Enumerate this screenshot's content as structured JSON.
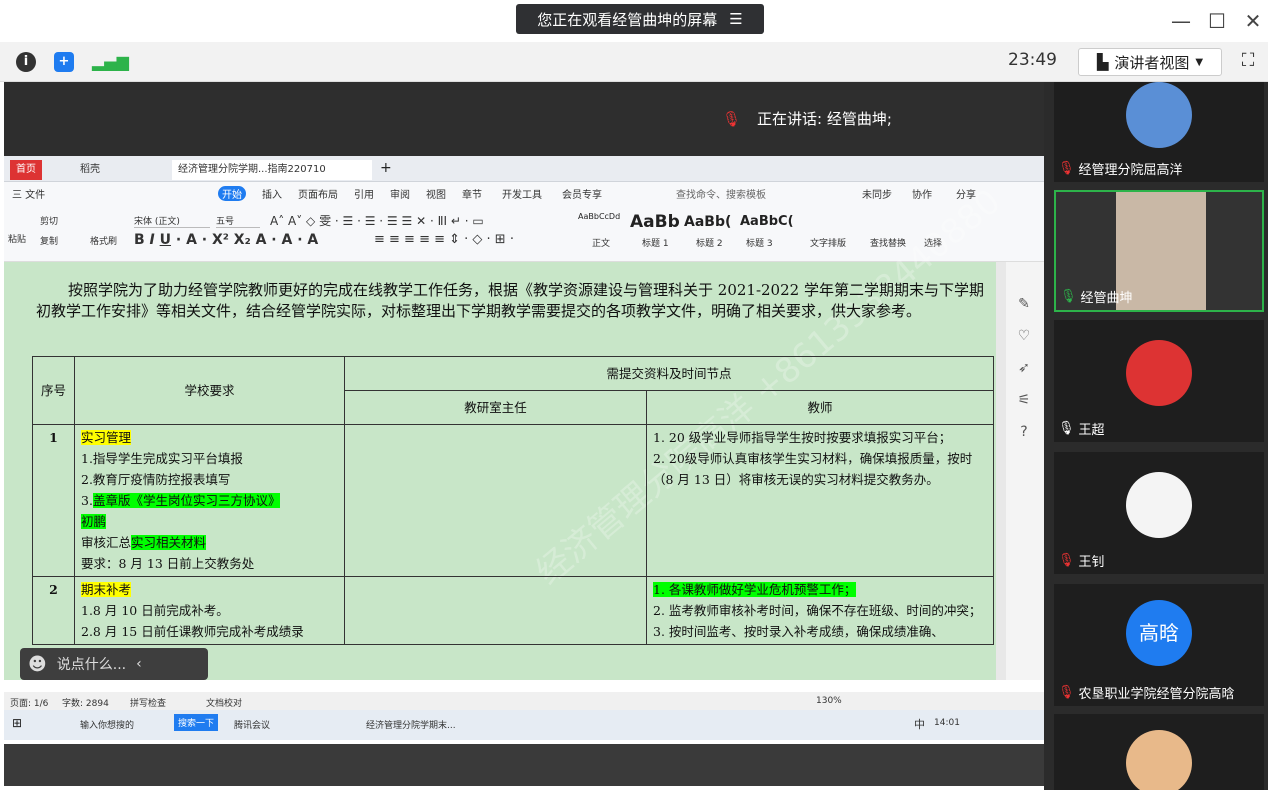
{
  "window": {
    "banner": "您正在观看经管曲坤的屏幕",
    "banner_icon": "menu-icon",
    "clock": "23:49",
    "presenter_view": "演讲者视图"
  },
  "speaker": {
    "speaking_label": "正在讲话: 经管曲坤;"
  },
  "wps": {
    "tabs": [
      "首页",
      "稻壳",
      "经济管理分院学期...指南220710"
    ],
    "menu": [
      "三 文件",
      "开始",
      "插入",
      "页面布局",
      "引用",
      "审阅",
      "视图",
      "章节",
      "开发工具",
      "会员专享"
    ],
    "search_placeholder": "查找命令、搜索模板",
    "sync": "未同步",
    "collab": "协作",
    "share": "分享",
    "ribbon": {
      "font": "宋体 (正文)",
      "size": "五号",
      "styles": [
        "正文",
        "标题 1",
        "标题 2",
        "标题 3"
      ],
      "style_samples": [
        "AaBbCcDd",
        "AaBb",
        "AaBb(",
        "AaBbC("
      ],
      "typeset": "文字排版",
      "findreplace": "查找替换",
      "select": "选择",
      "paste": "粘贴",
      "cut": "剪切",
      "copy": "复制",
      "format_painter": "格式刷"
    },
    "paragraph": "按照学院为了助力经管学院教师更好的完成在线教学工作任务，根据《教学资源建设与管理科关于 2021-2022 学年第二学期期末与下学期初教学工作安排》等相关文件，结合经管学院实际，对标整理出下学期教学需要提交的各项教学文件，明确了相关要求，供大家参考。",
    "table": {
      "h_seq": "序号",
      "h_school": "学校要求",
      "h_need": "需提交资料及时间节点",
      "h_director": "教研室主任",
      "h_teacher": "教师",
      "r1_seq": "1",
      "r1_title": "实习管理",
      "r1_l1": "1.指导学生完成实习平台填报",
      "r1_l2": "2.教育厅疫情防控报表填写",
      "r1_l3a": "3.",
      "r1_l3b": "盖章版《学生岗位实习三方协议》",
      "r1_l4": "初鹏",
      "r1_l5a": "审核汇总",
      "r1_l5b": "实习相关材料",
      "r1_l6": "要求：8 月 13 日前上交教务处",
      "r1_t1": "1. 20 级学业导师指导学生按时按要求填报实习平台；",
      "r1_t2": "2. 20级导师认真审核学生实习材料，确保填报质量，按时（8 月 13 日）将审核无误的实习材料提交教务办。",
      "r2_seq": "2",
      "r2_title": "期末补考",
      "r2_l1": "1.8 月 10 日前完成补考。",
      "r2_l2": "2.8 月 15 日前任课教师完成补考成绩录",
      "r2_t1": "1. 各课教师做好学业危机预警工作；",
      "r2_t2": "2. 监考教师审核补考时间，确保不存在班级、时间的冲突；",
      "r2_t3": "3. 按时间监考、按时录入补考成绩，确保成绩准确、"
    },
    "watermark": "经济管理分院高洋 +8613938440880",
    "status": {
      "page": "页面: 1/6",
      "words": "字数: 2894",
      "spell": "拼写检查",
      "proof": "文档校对",
      "zoom": "130%"
    },
    "taskbar": {
      "search": "输入你想搜的",
      "btn1": "搜索一下",
      "app1": "腾讯会议",
      "app2": "经济管理分院学期末...",
      "ime": "中",
      "time": "14:01"
    }
  },
  "chat": {
    "placeholder": "说点什么..."
  },
  "participants": [
    {
      "name": "经管理分院屈高洋",
      "muted": true
    },
    {
      "name": "经管曲坤",
      "muted": false
    },
    {
      "name": "王超",
      "muted": false
    },
    {
      "name": "王钊",
      "muted": true
    },
    {
      "name": "农垦职业学院经管分院高晗",
      "muted": true,
      "avatar_text": "高晗"
    }
  ],
  "colors": {
    "accent": "#1f7cf0",
    "highlight_yellow": "#ffff00",
    "highlight_green": "#00ff00",
    "doc_bg": "#c8e6c8"
  }
}
